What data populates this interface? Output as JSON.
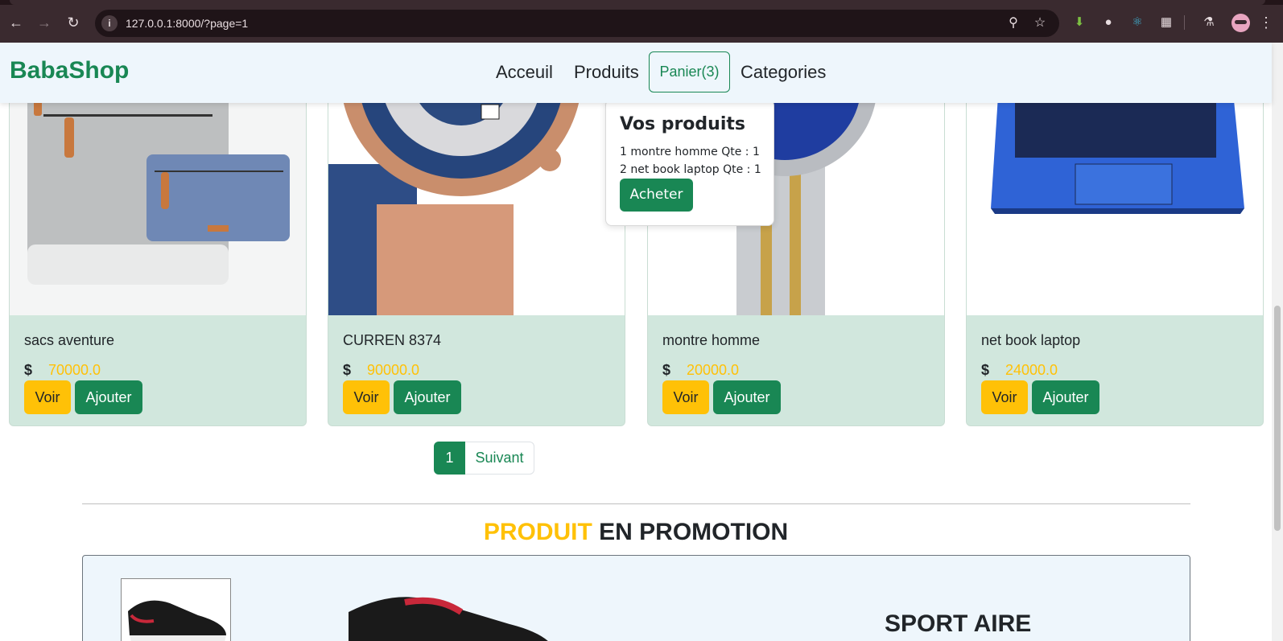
{
  "browser": {
    "url": "127.0.0.1:8000/?page=1"
  },
  "navbar": {
    "brand": "BabaShop",
    "links": [
      "Acceuil",
      "Produits",
      "Categories"
    ],
    "cart_label": "Panier(3)"
  },
  "cart_popover": {
    "title": "Vos produits",
    "items": [
      "1 montre homme Qte : 1",
      "2 net book laptop Qte : 1"
    ],
    "buy_label": "Acheter"
  },
  "products": [
    {
      "name": "sacs aventure",
      "currency": "$",
      "price": "70000.0",
      "view_label": "Voir",
      "add_label": "Ajouter"
    },
    {
      "name": "CURREN 8374",
      "currency": "$",
      "price": "90000.0",
      "view_label": "Voir",
      "add_label": "Ajouter"
    },
    {
      "name": "montre homme",
      "currency": "$",
      "price": "20000.0",
      "view_label": "Voir",
      "add_label": "Ajouter"
    },
    {
      "name": "net book laptop",
      "currency": "$",
      "price": "24000.0",
      "view_label": "Voir",
      "add_label": "Ajouter"
    }
  ],
  "pagination": {
    "current": "1",
    "next_label": "Suivant"
  },
  "promotion": {
    "title_highlight": "PRODUIT",
    "title_rest": " EN PROMOTION",
    "product_name": "SPORT AIRE"
  },
  "colors": {
    "brand": "#198754",
    "accent": "#ffc107",
    "card_bg": "#d1e7dd",
    "navbar_bg": "#eef6fc"
  }
}
